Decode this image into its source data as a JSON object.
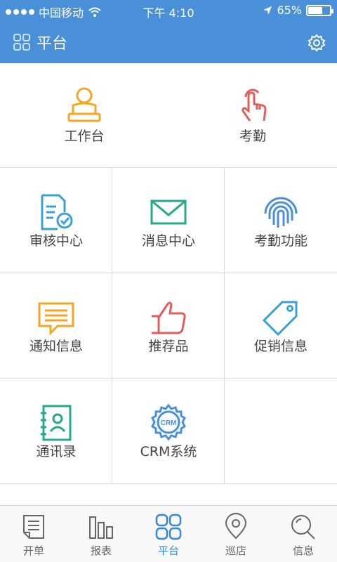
{
  "status_bar": {
    "carrier": "中国移动",
    "time": "下午 4:10",
    "battery": "65%",
    "battery_level": 0.65
  },
  "nav": {
    "title": "平台",
    "icons": {
      "left": "grid-icon",
      "right": "gear-icon"
    }
  },
  "top_tiles": [
    {
      "label": "工作台",
      "icon": "person-at-desk-icon",
      "color": "#f5a623"
    },
    {
      "label": "考勤",
      "icon": "finger-tap-icon",
      "color": "#e35d5d"
    }
  ],
  "grid_items": [
    {
      "label": "审核中心",
      "icon": "document-check-icon",
      "color": "#3aa0d8"
    },
    {
      "label": "消息中心",
      "icon": "envelope-icon",
      "color": "#26a98b"
    },
    {
      "label": "考勤功能",
      "icon": "fingerprint-icon",
      "color": "#4a8fd9"
    },
    {
      "label": "通知信息",
      "icon": "chat-lines-icon",
      "color": "#f5a623"
    },
    {
      "label": "推荐品",
      "icon": "thumbs-up-icon",
      "color": "#e35d5d"
    },
    {
      "label": "促销信息",
      "icon": "price-tag-icon",
      "color": "#3aa0d8"
    },
    {
      "label": "通讯录",
      "icon": "address-book-icon",
      "color": "#26a98b"
    },
    {
      "label": "CRM系统",
      "icon": "crm-gear-icon",
      "icon_text": "CRM",
      "color": "#4a8fd9"
    }
  ],
  "tabs": [
    {
      "label": "开单",
      "icon": "document-icon",
      "active": false
    },
    {
      "label": "报表",
      "icon": "bar-chart-icon",
      "active": false
    },
    {
      "label": "平台",
      "icon": "grid-icon",
      "active": true
    },
    {
      "label": "巡店",
      "icon": "map-pin-icon",
      "active": false
    },
    {
      "label": "信息",
      "icon": "search-icon",
      "active": false
    }
  ],
  "colors": {
    "primary": "#4a90d9",
    "active_tab": "#3a86d6",
    "inactive_tab": "#666666",
    "divider": "#dcdcdc"
  }
}
